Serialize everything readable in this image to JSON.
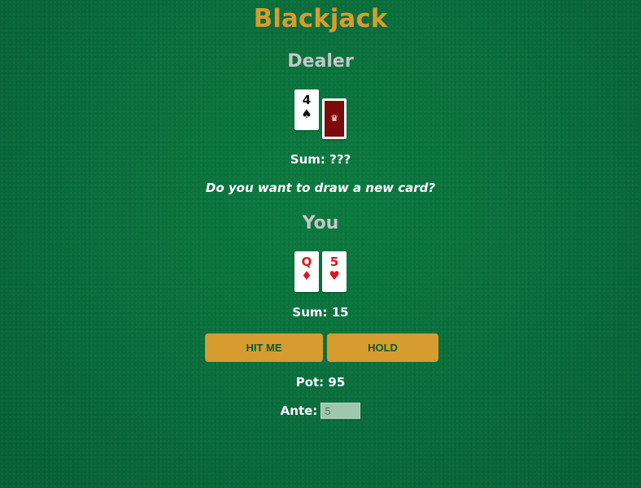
{
  "game": {
    "title": "Blackjack",
    "prompt": "Do you want to draw a new card?"
  },
  "dealer": {
    "heading": "Dealer",
    "sum_label": "Sum: ???",
    "cards": [
      {
        "rank": "4",
        "suit": "♠",
        "color": "black",
        "face_down": false
      },
      {
        "rank": "",
        "suit": "♛",
        "color": "back",
        "face_down": true
      }
    ]
  },
  "player": {
    "heading": "You",
    "sum_label": "Sum: 15",
    "cards": [
      {
        "rank": "Q",
        "suit": "♦",
        "color": "red",
        "face_down": false
      },
      {
        "rank": "5",
        "suit": "♥",
        "color": "red",
        "face_down": false
      }
    ]
  },
  "actions": {
    "hit_label": "HIT ME",
    "hold_label": "HOLD"
  },
  "pot": {
    "label": "Pot: 95"
  },
  "ante": {
    "label": "Ante:",
    "value": "5"
  },
  "colors": {
    "felt": "#0a6f3a",
    "accent": "#d69c2f",
    "card_back": "#7d0a0a",
    "red_suit": "#e0141e"
  }
}
